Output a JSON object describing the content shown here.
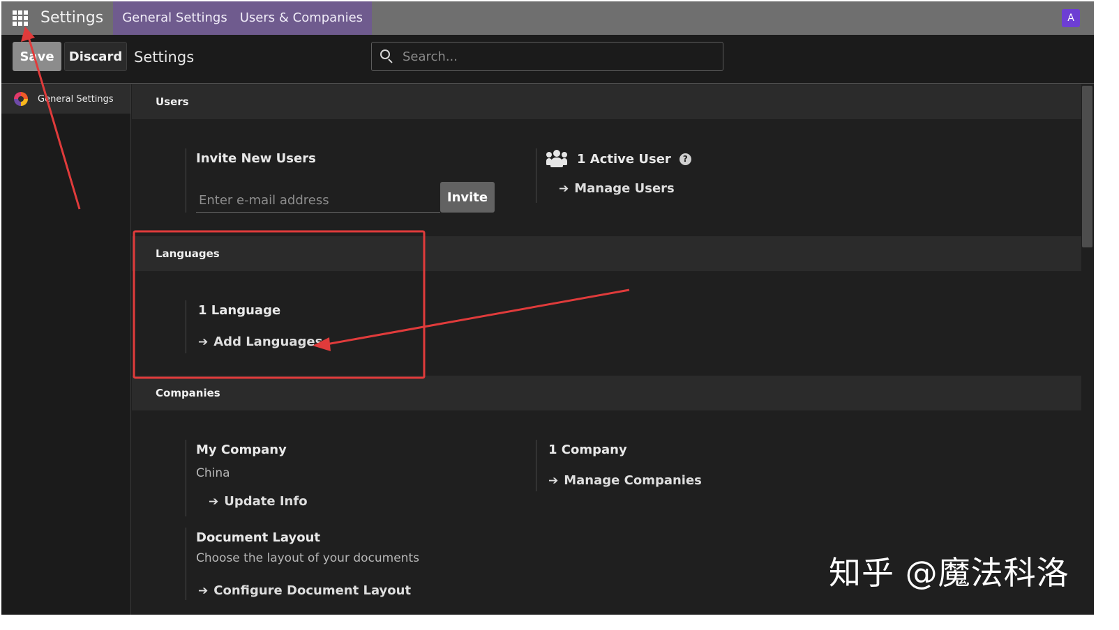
{
  "navbar": {
    "brand": "Settings",
    "tabs": [
      "General Settings",
      "Users & Companies"
    ],
    "avatar_letter": "A"
  },
  "control_panel": {
    "save_label": "Save",
    "discard_label": "Discard",
    "title": "Settings",
    "search_placeholder": "Search..."
  },
  "sidebar": {
    "items": [
      {
        "label": "General Settings",
        "icon": "app-logo-icon"
      }
    ]
  },
  "sections": {
    "users": {
      "header": "Users",
      "invite_title": "Invite New Users",
      "email_placeholder": "Enter e-mail address",
      "invite_button": "Invite",
      "active_users": "1 Active User",
      "manage_users": "Manage Users"
    },
    "languages": {
      "header": "Languages",
      "count": "1 Language",
      "add_languages": "Add Languages"
    },
    "companies": {
      "header": "Companies",
      "company_name": "My Company",
      "company_country": "China",
      "update_info": "Update Info",
      "company_count": "1 Company",
      "manage_companies": "Manage Companies",
      "document_layout_title": "Document Layout",
      "document_layout_desc": "Choose the layout of your documents",
      "configure_layout": "Configure Document Layout"
    }
  },
  "watermark": "知乎 @魔法科洛",
  "annotation_color": "#e03b3b"
}
